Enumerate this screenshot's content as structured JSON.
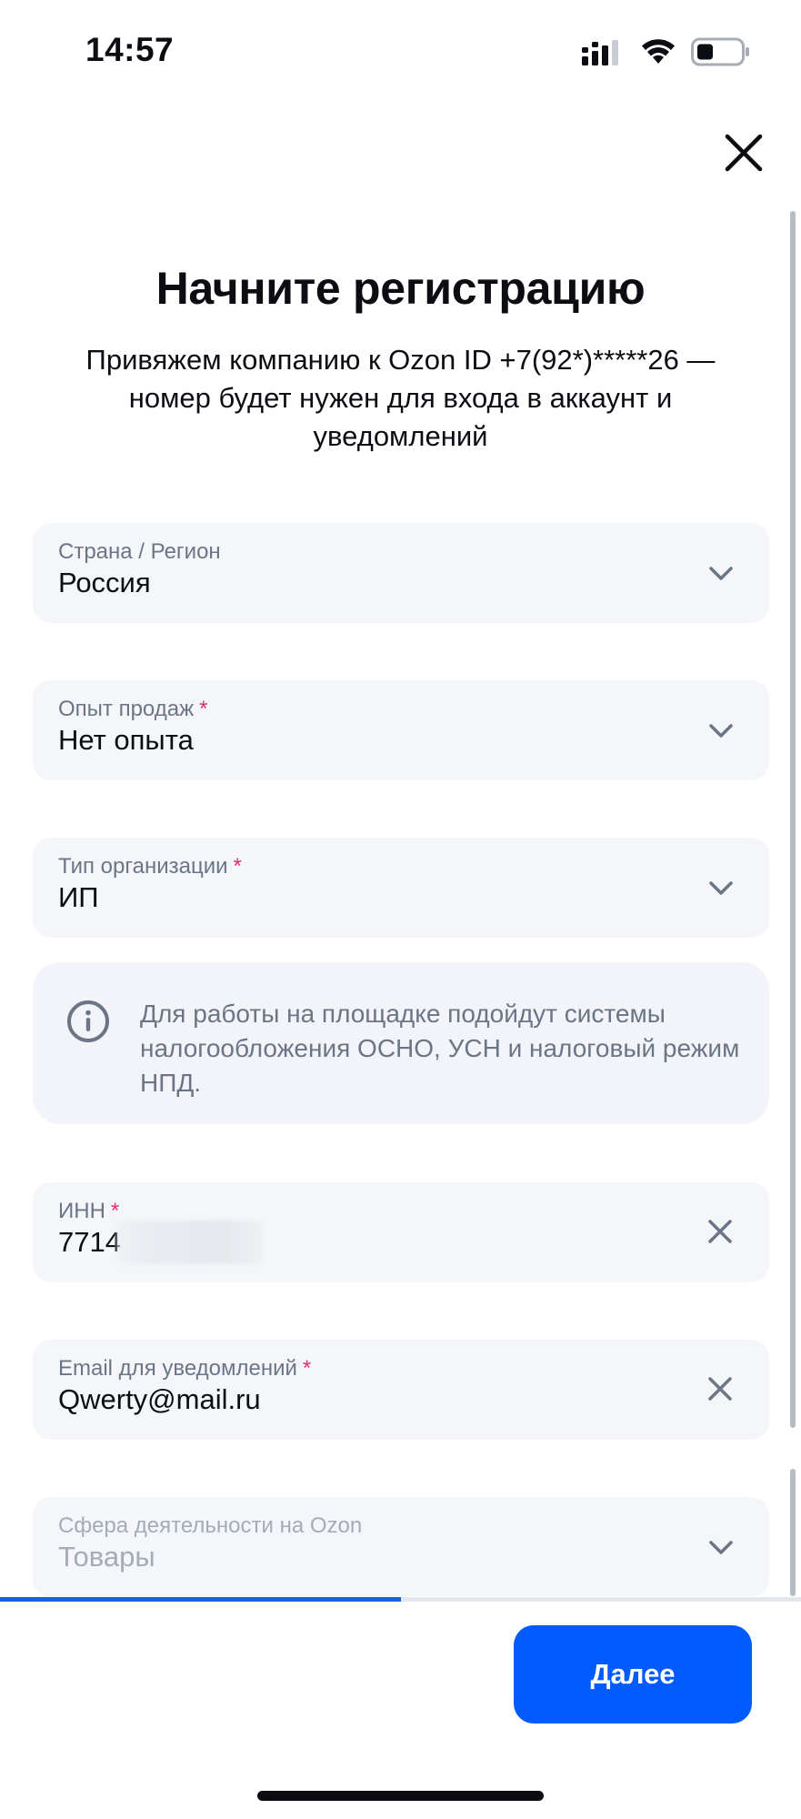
{
  "status_bar": {
    "time": "14:57",
    "icons": [
      "cellular-signal-icon",
      "wifi-icon",
      "battery-icon"
    ]
  },
  "header": {
    "close_icon": "close-icon"
  },
  "main": {
    "title": "Начните регистрацию",
    "subtitle": "Привяжем компанию к Ozon ID +7(92*)*****26 — номер будет нужен для входа в аккаунт и уведомлений",
    "fields": {
      "country": {
        "label": "Страна / Регион",
        "value": "Россия"
      },
      "experience": {
        "label": "Опыт продаж",
        "required_mark": "*",
        "value": "Нет опыта"
      },
      "org_type": {
        "label": "Тип организации",
        "required_mark": "*",
        "value": "ИП"
      },
      "inn": {
        "label": "ИНН",
        "required_mark": "*",
        "value": "7714"
      },
      "email": {
        "label": "Email для уведомлений",
        "required_mark": "*",
        "value": "Qwerty@mail.ru"
      },
      "activity": {
        "label": "Сфера деятельности на Ozon",
        "value": "Товары"
      }
    },
    "info": {
      "icon": "info-icon",
      "text": "Для работы на площадке подойдут системы налогообложения ОСНО, УСН и налоговый режим НПД."
    }
  },
  "footer": {
    "progress": 0.5,
    "next_label": "Далее"
  },
  "colors": {
    "accent": "#005bff",
    "required": "#e0316b",
    "field_bg": "#f4f6fa",
    "muted_text": "#6c7585"
  }
}
